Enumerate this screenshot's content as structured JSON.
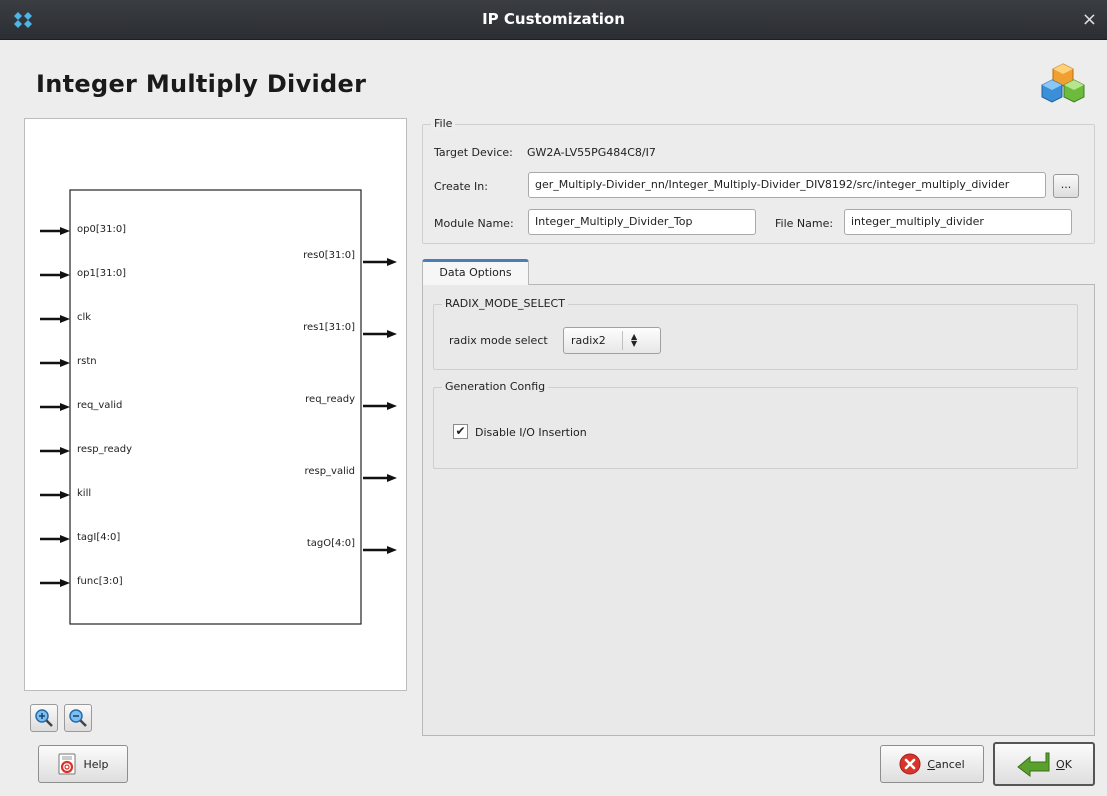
{
  "window": {
    "title": "IP Customization",
    "close_glyph": "×",
    "icon": "gowin-logo-icon"
  },
  "heading": "Integer Multiply Divider",
  "brand_icon": "cubes-icon",
  "symbol": {
    "inputs": [
      "op0[31:0]",
      "op1[31:0]",
      "clk",
      "rstn",
      "req_valid",
      "resp_ready",
      "kill",
      "tagI[4:0]",
      "func[3:0]"
    ],
    "outputs": [
      "res0[31:0]",
      "res1[31:0]",
      "req_ready",
      "resp_valid",
      "tagO[4:0]"
    ]
  },
  "zoom": {
    "in_icon": "zoom-in-icon",
    "out_icon": "zoom-out-icon"
  },
  "file": {
    "group_label": "File",
    "target_device_label": "Target Device:",
    "target_device": "GW2A-LV55PG484C8/I7",
    "create_in_label": "Create In:",
    "create_in": "ger_Multiply-Divider_nn/Integer_Multiply-Divider_DIV8192/src/integer_multiply_divider",
    "browse_label": "...",
    "module_name_label": "Module Name:",
    "module_name": "Integer_Multiply_Divider_Top",
    "file_name_label": "File Name:",
    "file_name": "integer_multiply_divider"
  },
  "tabs": [
    {
      "label": "Data Options",
      "active": true
    }
  ],
  "radix": {
    "group_label": "RADIX_MODE_SELECT",
    "field_label": "radix mode select",
    "value": "radix2"
  },
  "generation": {
    "group_label": "Generation Config",
    "checkbox_label": "Disable I/O Insertion",
    "checked": true,
    "check_glyph": "✔"
  },
  "buttons": {
    "help": "Help",
    "cancel_mnemonic": "C",
    "cancel_rest": "ancel",
    "ok_mnemonic": "O",
    "ok_rest": "K"
  },
  "colors": {
    "accent": "#4a7fb5",
    "titlebar": "#2e3136",
    "cancel_red": "#d9342b",
    "ok_green": "#5aa02c"
  }
}
